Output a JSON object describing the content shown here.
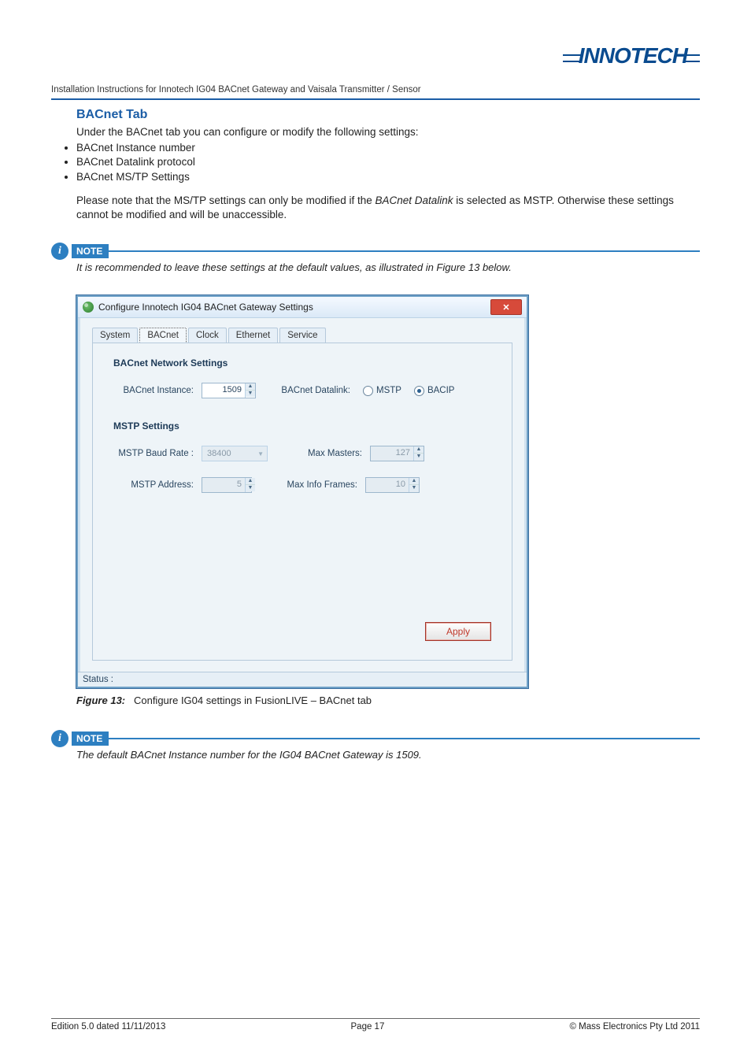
{
  "brand": "INNOTECH",
  "header": "Installation Instructions for Innotech IG04 BACnet Gateway and Vaisala Transmitter / Sensor",
  "section": {
    "title": "BACnet Tab",
    "intro": "Under the BACnet tab you can configure or modify the following settings:",
    "bullets": [
      "BACnet Instance number",
      "BACnet Datalink protocol",
      "BACnet MS/TP Settings"
    ],
    "para2a": "Please note that the MS/TP settings can only be modified if the ",
    "para2_em": "BACnet Datalink",
    "para2b": " is selected as MSTP. Otherwise these settings cannot be modified and will be unaccessible."
  },
  "note1": {
    "label": "NOTE",
    "text": "It is recommended to leave these settings at the default values, as illustrated in Figure 13 below."
  },
  "window": {
    "title": "Configure Innotech IG04 BACnet Gateway Settings",
    "tabs": [
      "System",
      "BACnet",
      "Clock",
      "Ethernet",
      "Service"
    ],
    "active_tab": 1,
    "group1": "BACnet Network Settings",
    "fields": {
      "instance_label": "BACnet Instance:",
      "instance_value": "1509",
      "datalink_label": "BACnet Datalink:",
      "radio_mstp": "MSTP",
      "radio_bacip": "BACIP",
      "radio_selected": "BACIP"
    },
    "group2": "MSTP Settings",
    "mstp": {
      "baud_label": "MSTP Baud Rate :",
      "baud_value": "38400",
      "maxmasters_label": "Max Masters:",
      "maxmasters_value": "127",
      "addr_label": "MSTP Address:",
      "addr_value": "5",
      "maxinfo_label": "Max Info Frames:",
      "maxinfo_value": "10"
    },
    "apply": "Apply",
    "status_label": "Status :"
  },
  "figure": {
    "label": "Figure 13:",
    "caption": "Configure IG04 settings in FusionLIVE – BACnet tab"
  },
  "note2": {
    "label": "NOTE",
    "text": "The default BACnet Instance number for the IG04 BACnet Gateway is 1509."
  },
  "footer": {
    "left": "Edition 5.0 dated 11/11/2013",
    "center": "Page 17",
    "right": "© Mass Electronics Pty Ltd  2011"
  }
}
